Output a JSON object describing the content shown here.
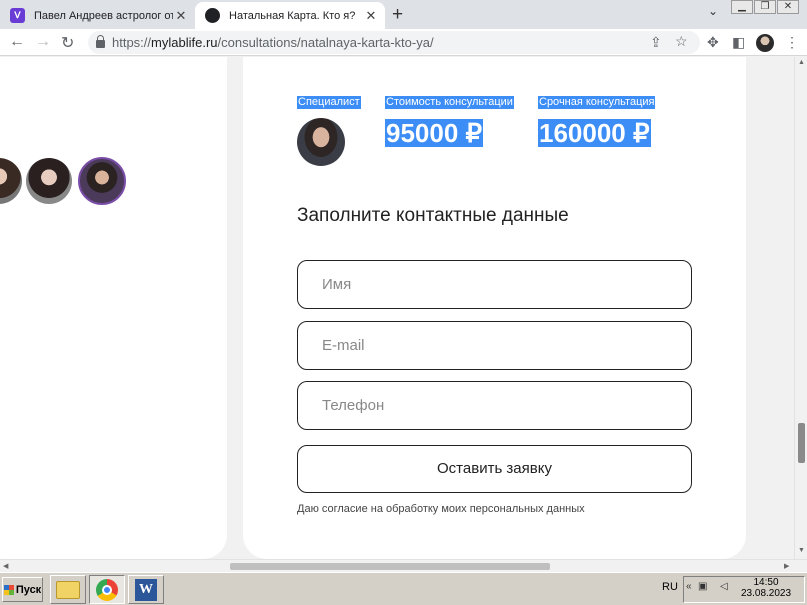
{
  "browser": {
    "tabs": [
      {
        "title": "Павел Андреев астролог отзывы:",
        "active": false
      },
      {
        "title": "Натальная Карта. Кто я?",
        "active": true
      }
    ],
    "url_prefix": "https://",
    "url_host": "mylablife.ru",
    "url_path": "/consultations/natalnaya-karta-kto-ya/"
  },
  "page": {
    "left_heading_fragment": "",
    "card_heading_fragment": "",
    "columns": {
      "specialist_label": "Специалист",
      "cost_label": "Стоимость консультации",
      "urgent_label": "Срочная консультация",
      "cost_value": "95000 ₽",
      "urgent_value": "160000 ₽"
    },
    "form": {
      "title": "Заполните контактные данные",
      "name_placeholder": "Имя",
      "email_placeholder": "E-mail",
      "phone_placeholder": "Телефон",
      "submit_label": "Оставить заявку",
      "consent_text": "Даю согласие на обработку моих персональных данных"
    },
    "selection_color": "#3c8df6"
  },
  "taskbar": {
    "start_label": "Пуск",
    "language": "RU",
    "time": "14:50",
    "date": "23.08.2023"
  }
}
